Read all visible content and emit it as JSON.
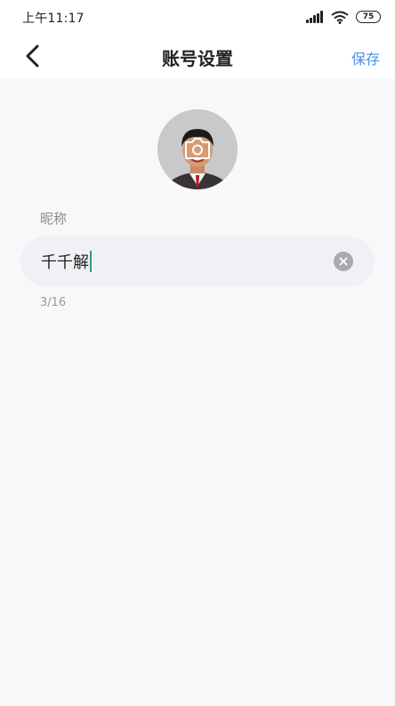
{
  "status_bar": {
    "time": "上午11:17",
    "battery": "75",
    "icons": [
      "signal-icon",
      "wifi-icon",
      "battery-icon"
    ]
  },
  "nav": {
    "back_icon": "chevron-left-icon",
    "title": "账号设置",
    "save_label": "保存"
  },
  "avatar": {
    "overlay_icon": "camera-icon"
  },
  "nickname": {
    "label": "昵称",
    "value": "千千解",
    "char_count": "3/16",
    "clear_icon": "clear-icon"
  },
  "colors": {
    "accent": "#4a8fe8",
    "background": "#f7f8fa",
    "input_bg": "#f0f1f4",
    "caret": "#2a9d78"
  }
}
